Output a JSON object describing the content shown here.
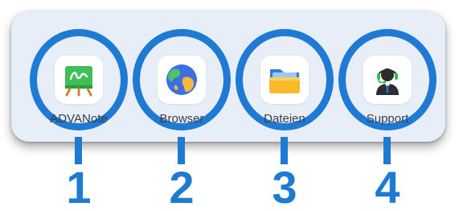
{
  "dock": {
    "apps": [
      {
        "label": "ADVANote",
        "icon": "whiteboard-icon",
        "number": "1"
      },
      {
        "label": "Browser",
        "icon": "globe-icon",
        "number": "2"
      },
      {
        "label": "Dateien",
        "icon": "folder-icon",
        "number": "3"
      },
      {
        "label": "Support",
        "icon": "headset-agent-icon",
        "number": "4"
      }
    ]
  },
  "colors": {
    "highlight": "#1f7ad3",
    "dock_background": "#e7eef8"
  }
}
